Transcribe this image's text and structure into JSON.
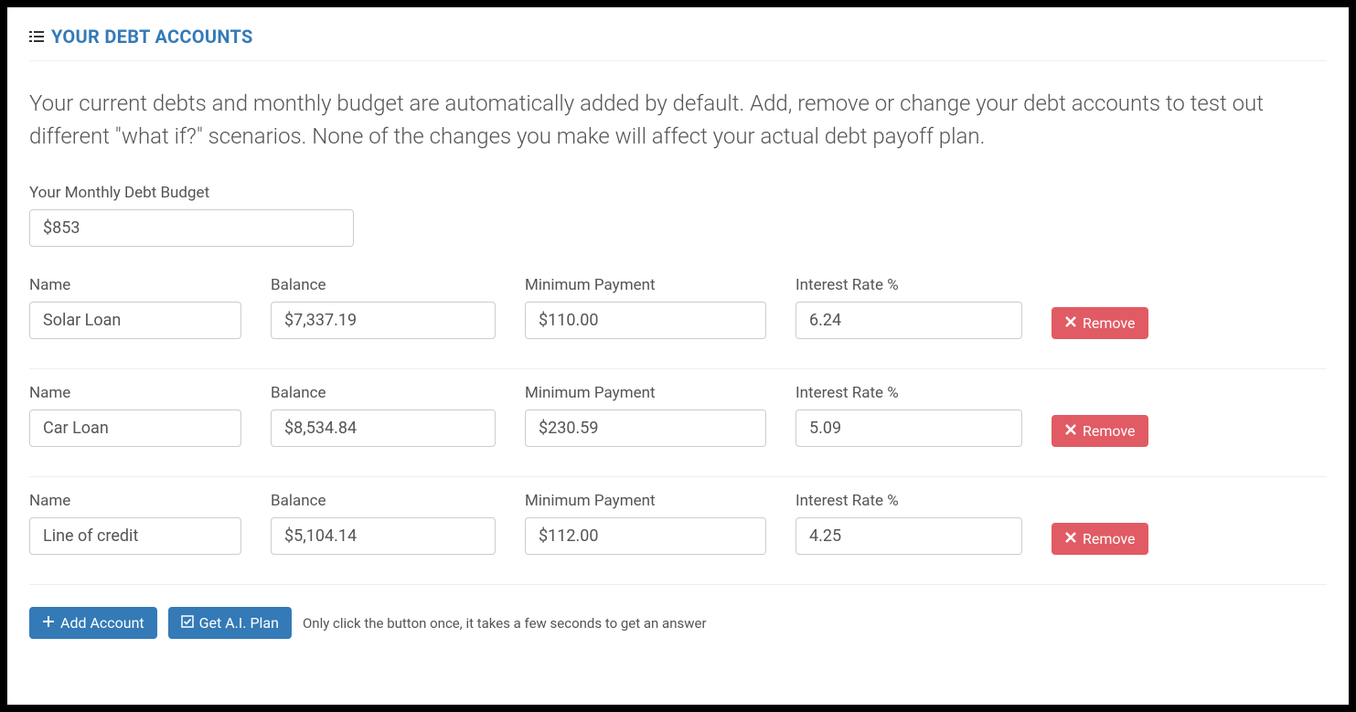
{
  "header": {
    "title": "YOUR DEBT ACCOUNTS"
  },
  "description": "Your current debts and monthly budget are automatically added by default. Add, remove or change your debt accounts to test out different \"what if?\" scenarios. None of the changes you make will affect your actual debt payoff plan.",
  "budget": {
    "label": "Your Monthly Debt Budget",
    "value": "$853"
  },
  "columns": {
    "name": "Name",
    "balance": "Balance",
    "minimum_payment": "Minimum Payment",
    "interest_rate": "Interest Rate %"
  },
  "remove_label": "Remove",
  "accounts": [
    {
      "name": "Solar Loan",
      "balance": "$7,337.19",
      "minimum_payment": "$110.00",
      "interest_rate": "6.24"
    },
    {
      "name": "Car Loan",
      "balance": "$8,534.84",
      "minimum_payment": "$230.59",
      "interest_rate": "5.09"
    },
    {
      "name": "Line of credit",
      "balance": "$5,104.14",
      "minimum_payment": "$112.00",
      "interest_rate": "4.25"
    }
  ],
  "footer": {
    "add_label": "Add Account",
    "plan_label": "Get A.I. Plan",
    "hint": "Only click the button once, it takes a few seconds to get an answer"
  }
}
